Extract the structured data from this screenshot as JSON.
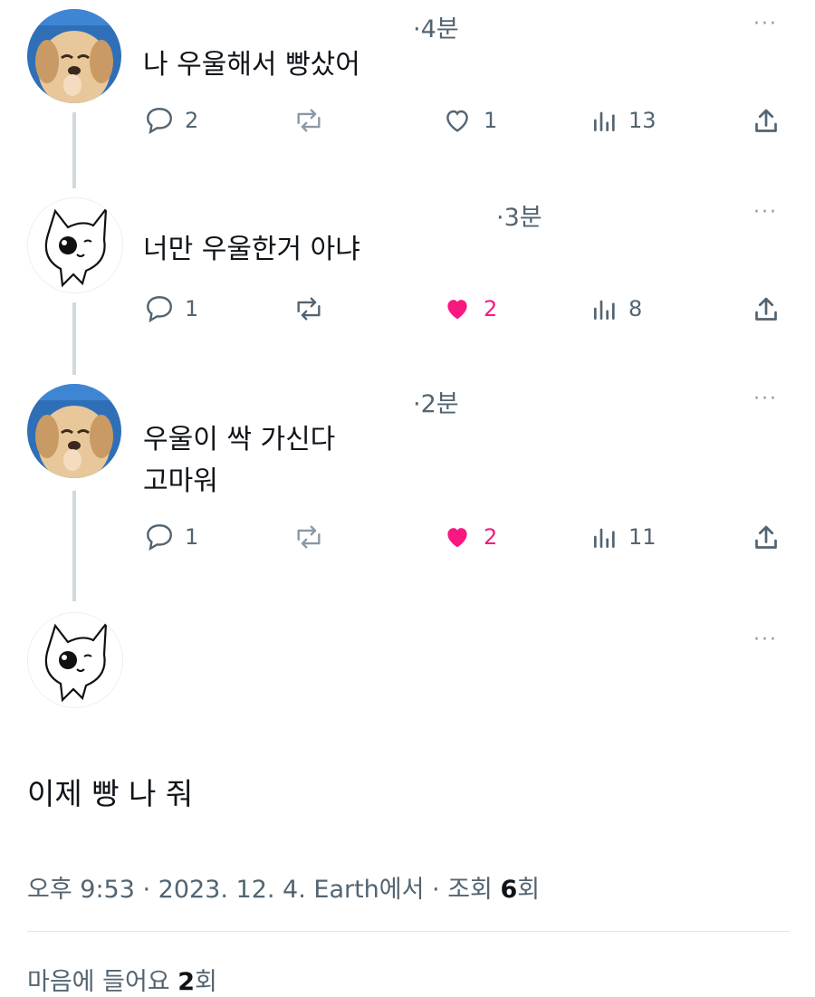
{
  "replies": [
    {
      "avatar": "puppy-avatar",
      "time": "·4분",
      "text_lines": [
        "나 우울해서 빵샀어"
      ],
      "comments": "2",
      "likes": "1",
      "liked": false,
      "views": "13"
    },
    {
      "avatar": "cat-avatar",
      "time": "·3분",
      "text_lines": [
        "너만 우울한거 아냐"
      ],
      "comments": "1",
      "likes": "2",
      "liked": true,
      "views": "8"
    },
    {
      "avatar": "puppy-avatar",
      "time": "·2분",
      "text_lines": [
        "우울이 싹 가신다",
        "고마워"
      ],
      "comments": "1",
      "likes": "2",
      "liked": true,
      "views": "11"
    }
  ],
  "main_tweet": {
    "avatar": "cat-avatar",
    "text": "이제 빵 나 줘",
    "meta_prefix": "오후 9:53 · 2023. 12. 4. Earth에서 · 조회 ",
    "views_count": "6",
    "views_suffix": "회",
    "likes_prefix": "마음에 들어요 ",
    "likes_count": "2",
    "likes_suffix": "회"
  },
  "more_label": "···",
  "colors": {
    "liked_pink": "#f91880",
    "secondary_text": "#536471",
    "thread_line": "#cfd9de"
  }
}
